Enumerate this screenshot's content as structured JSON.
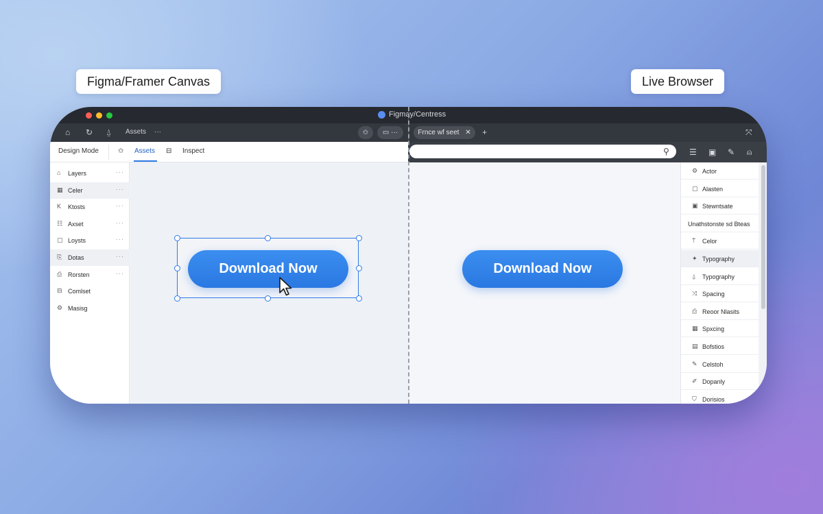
{
  "labels": {
    "left_tag": "Figma/Framer Canvas",
    "right_tag": "Live Browser"
  },
  "window": {
    "title": "Figmay/Centress"
  },
  "toolbar": {
    "assets_label": "Assets",
    "more": "···",
    "tab_pill": "Frnce wf seet",
    "tab_close": "✕",
    "new_tab": "+",
    "expand": "⤧"
  },
  "tabs": {
    "design_mode": "Design Mode",
    "assets": "Assets",
    "inspect": "Inspect"
  },
  "layers": [
    {
      "icon": "⌂",
      "label": "Layers",
      "more": "···",
      "selected": false
    },
    {
      "icon": "▦",
      "label": "Celer",
      "more": "···",
      "selected": true
    },
    {
      "icon": "K",
      "label": "Ktosts",
      "more": "···",
      "selected": false
    },
    {
      "icon": "☷",
      "label": "Axset",
      "more": "···",
      "selected": false
    },
    {
      "icon": "▢",
      "label": "Loysts",
      "more": "···",
      "selected": false
    },
    {
      "icon": "⎘",
      "label": "Dotas",
      "more": "···",
      "selected": true
    },
    {
      "icon": "⎙",
      "label": "Rorsten",
      "more": "···",
      "selected": false
    },
    {
      "icon": "⊟",
      "label": "Comlset",
      "more": "",
      "selected": false
    },
    {
      "icon": "⚙",
      "label": "Masisg",
      "more": "",
      "selected": false
    }
  ],
  "canvas": {
    "button_label": "Download Now"
  },
  "browser": {
    "url_value": "",
    "button_label": "Download Now"
  },
  "right_panel": [
    {
      "icon": "⚙",
      "label": "Actor"
    },
    {
      "icon": "▢",
      "label": "Alasten"
    },
    {
      "icon": "▣",
      "label": "Stewntsate"
    },
    {
      "icon": "",
      "label": "Unathstonste sd Bteas",
      "note": true
    },
    {
      "icon": "⍑",
      "label": "Celor"
    },
    {
      "icon": "✦",
      "label": "Typography",
      "selected": true
    },
    {
      "icon": "⍙",
      "label": "Typography"
    },
    {
      "icon": "⤨",
      "label": "Spacing"
    },
    {
      "icon": "⎙",
      "label": "Reoor Nlasits"
    },
    {
      "icon": "▦",
      "label": "Spxcing"
    },
    {
      "icon": "▤",
      "label": "Bofstios"
    },
    {
      "icon": "✎",
      "label": "Celstoh"
    },
    {
      "icon": "✐",
      "label": "Dopanly"
    },
    {
      "icon": "⛉",
      "label": "Dorisios"
    }
  ],
  "colors": {
    "accent": "#2f7be6",
    "button": "#2a78e2"
  }
}
